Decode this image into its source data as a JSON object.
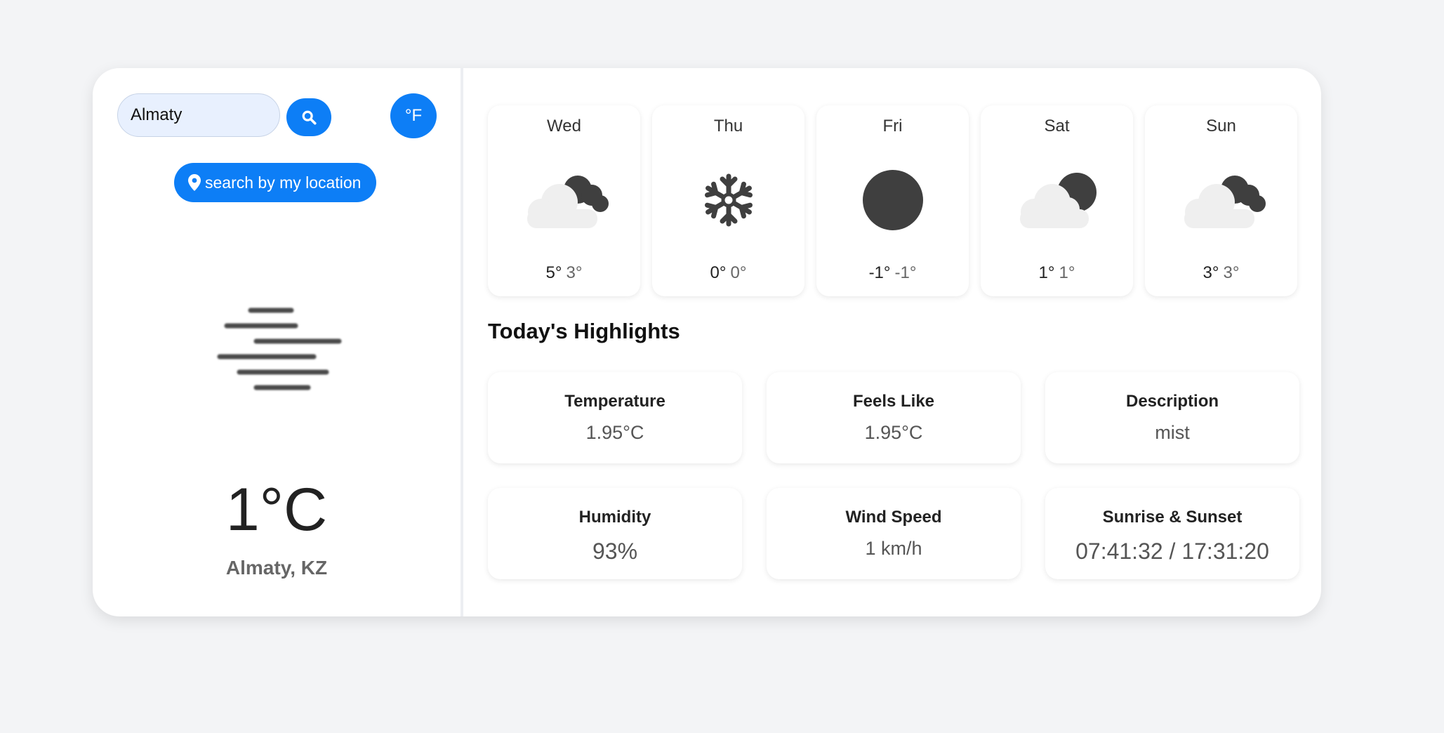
{
  "search": {
    "value": "Almaty",
    "placeholder": ""
  },
  "unit_toggle_label": "°F",
  "location_button_label": "search by my location",
  "current": {
    "temperature": "1°C",
    "city": "Almaty, KZ",
    "icon": "mist-icon"
  },
  "forecast": [
    {
      "day": "Wed",
      "icon": "cloud-moon-icon",
      "high": "5°",
      "low": "3°"
    },
    {
      "day": "Thu",
      "icon": "snowflake-icon",
      "high": "0°",
      "low": "0°"
    },
    {
      "day": "Fri",
      "icon": "moon-icon",
      "high": "-1°",
      "low": "-1°"
    },
    {
      "day": "Sat",
      "icon": "cloud-moon-icon",
      "high": "1°",
      "low": "1°"
    },
    {
      "day": "Sun",
      "icon": "cloud-moon-icon",
      "high": "3°",
      "low": "3°"
    }
  ],
  "highlights": {
    "title": "Today's Highlights",
    "items": [
      {
        "label": "Temperature",
        "value": "1.95°C"
      },
      {
        "label": "Feels Like",
        "value": "1.95°C"
      },
      {
        "label": "Description",
        "value": "mist"
      },
      {
        "label": "Humidity",
        "value": "93%"
      },
      {
        "label": "Wind Speed",
        "value": "1 km/h"
      },
      {
        "label": "Sunrise & Sunset",
        "value": "07:41:32 / 17:31:20"
      }
    ]
  },
  "colors": {
    "accent": "#0d7ef6",
    "icon_dark": "#3f3f3f",
    "cloud": "#efefef",
    "background": "#f3f4f6"
  }
}
